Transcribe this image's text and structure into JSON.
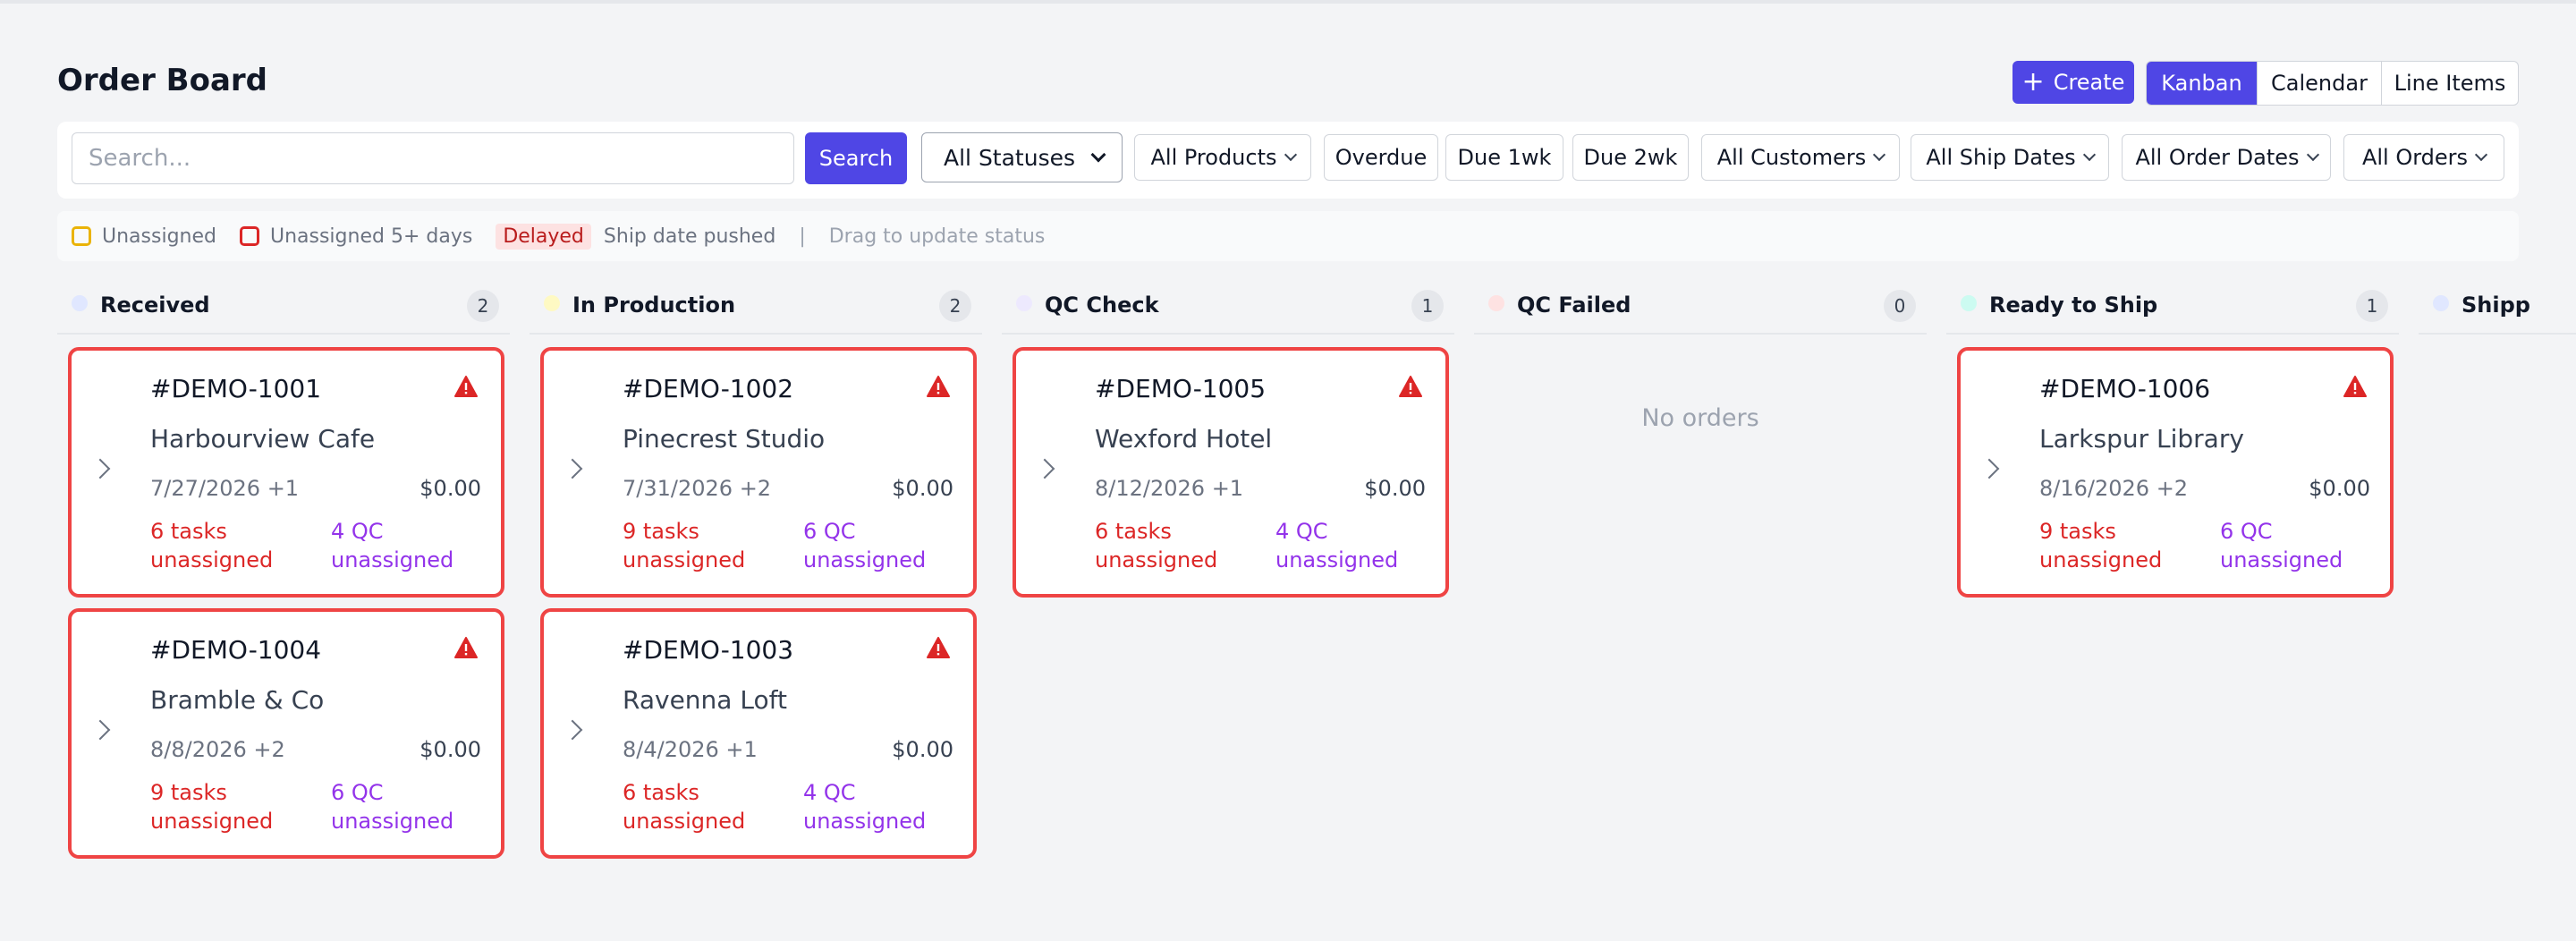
{
  "header": {
    "title": "Order Board",
    "create_label": "Create",
    "views": [
      "Kanban",
      "Calendar",
      "Line Items"
    ],
    "active_view": "Kanban"
  },
  "filters": {
    "search_placeholder": "Search...",
    "search_button": "Search",
    "status_select": "All Statuses",
    "products": "All Products",
    "overdue": "Overdue",
    "due_1wk": "Due 1wk",
    "due_2wk": "Due 2wk",
    "customers": "All Customers",
    "ship_dates": "All Ship Dates",
    "order_dates": "All Order Dates",
    "orders": "All Orders"
  },
  "legend": {
    "unassigned": "Unassigned",
    "unassigned_5": "Unassigned 5+ days",
    "delayed_badge": "Delayed",
    "delayed_text": "Ship date pushed",
    "separator": "|",
    "hint": "Drag to update status"
  },
  "colors": {
    "accent": "#4f46e5",
    "alert_border": "#ef4444",
    "tasks_text": "#dc2626",
    "qc_text": "#9333ea"
  },
  "columns": [
    {
      "title": "Received",
      "count": "2",
      "dot_color": "#e0e7ff",
      "empty_text": "",
      "cards": [
        {
          "order": "#DEMO-1001",
          "customer": "Harbourview Cafe",
          "date": "7/27/2026 +1",
          "amount": "$0.00",
          "tasks": "6 tasks unassigned",
          "qc": "4 QC unassigned"
        },
        {
          "order": "#DEMO-1004",
          "customer": "Bramble & Co",
          "date": "8/8/2026 +2",
          "amount": "$0.00",
          "tasks": "9 tasks unassigned",
          "qc": "6 QC unassigned"
        }
      ]
    },
    {
      "title": "In Production",
      "count": "2",
      "dot_color": "#fef9c3",
      "empty_text": "",
      "cards": [
        {
          "order": "#DEMO-1002",
          "customer": "Pinecrest Studio",
          "date": "7/31/2026 +2",
          "amount": "$0.00",
          "tasks": "9 tasks unassigned",
          "qc": "6 QC unassigned"
        },
        {
          "order": "#DEMO-1003",
          "customer": "Ravenna Loft",
          "date": "8/4/2026 +1",
          "amount": "$0.00",
          "tasks": "6 tasks unassigned",
          "qc": "4 QC unassigned"
        }
      ]
    },
    {
      "title": "QC Check",
      "count": "1",
      "dot_color": "#ede9fe",
      "empty_text": "",
      "cards": [
        {
          "order": "#DEMO-1005",
          "customer": "Wexford Hotel",
          "date": "8/12/2026 +1",
          "amount": "$0.00",
          "tasks": "6 tasks unassigned",
          "qc": "4 QC unassigned"
        }
      ]
    },
    {
      "title": "QC Failed",
      "count": "0",
      "dot_color": "#fee2e2",
      "empty_text": "No orders",
      "cards": []
    },
    {
      "title": "Ready to Ship",
      "count": "1",
      "dot_color": "#ccfbf1",
      "empty_text": "",
      "cards": [
        {
          "order": "#DEMO-1006",
          "customer": "Larkspur Library",
          "date": "8/16/2026 +2",
          "amount": "$0.00",
          "tasks": "9 tasks unassigned",
          "qc": "6 QC unassigned"
        }
      ]
    },
    {
      "title": "Shipp",
      "count": "",
      "dot_color": "#e0e7ff",
      "empty_text": "",
      "cards": []
    }
  ]
}
